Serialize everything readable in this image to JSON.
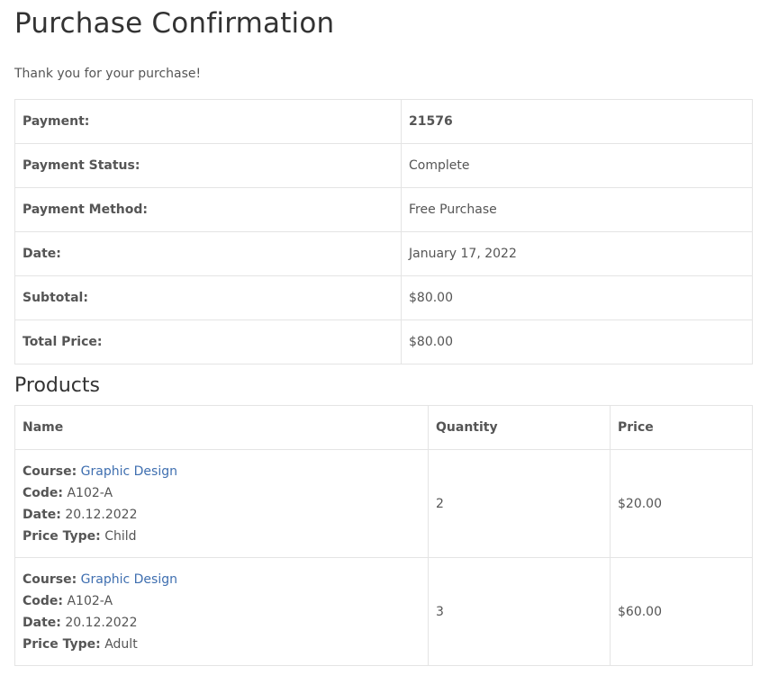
{
  "page": {
    "title": "Purchase Confirmation",
    "intro": "Thank you for your purchase!"
  },
  "summary": {
    "rows": [
      {
        "label": "Payment:",
        "value": "21576"
      },
      {
        "label": "Payment Status:",
        "value": "Complete"
      },
      {
        "label": "Payment Method:",
        "value": "Free Purchase"
      },
      {
        "label": "Date:",
        "value": "January 17, 2022"
      },
      {
        "label": "Subtotal:",
        "value": "$80.00"
      },
      {
        "label": "Total Price:",
        "value": "$80.00"
      }
    ]
  },
  "products": {
    "heading": "Products",
    "headers": {
      "name": "Name",
      "quantity": "Quantity",
      "price": "Price"
    },
    "field_labels": {
      "course": "Course:",
      "code": "Code:",
      "date": "Date:",
      "price_type": "Price Type:"
    },
    "items": [
      {
        "course": "Graphic Design",
        "code": "A102-A",
        "date": "20.12.2022",
        "price_type": "Child",
        "quantity": "2",
        "price": "$20.00"
      },
      {
        "course": "Graphic Design",
        "code": "A102-A",
        "date": "20.12.2022",
        "price_type": "Adult",
        "quantity": "3",
        "price": "$60.00"
      }
    ]
  },
  "colors": {
    "link": "#3f6fb0",
    "text": "#555555",
    "heading": "#333333",
    "border": "#e4e4e4"
  }
}
